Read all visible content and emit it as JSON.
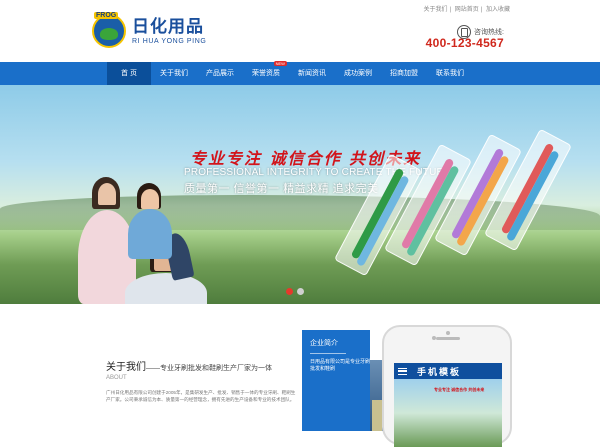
{
  "header": {
    "logo": {
      "badge": "FROG",
      "name": "日化用品",
      "pinyin": "RI HUA YONG PING"
    },
    "toplinks": [
      "关于我们",
      "网站首页",
      "加入收藏"
    ],
    "hotline_label": "咨询热线:",
    "hotline_number": "400-123-4567"
  },
  "nav": {
    "items": [
      {
        "label": "首 页",
        "active": true
      },
      {
        "label": "关于我们"
      },
      {
        "label": "产品展示"
      },
      {
        "label": "荣誉资质",
        "badge": "NEW"
      },
      {
        "label": "新闻资讯"
      },
      {
        "label": "成功案例"
      },
      {
        "label": "招商加盟"
      },
      {
        "label": "联系我们"
      }
    ]
  },
  "banner": {
    "slogan_cn": "专业专注 诚信合作 共创未来",
    "slogan_en": "PROFESSIONAL INTEGRITY TO CREATE THE FUTURE",
    "slogan_sub": "质量第一 信誉第一 精益求精 追求完美",
    "slides": 2,
    "active_slide": 1
  },
  "about": {
    "title": "关于我们",
    "subtitle": "——专业牙刷批发和鞋刷生产厂家为一体",
    "label": "ABOUT",
    "text": "广州日化用品有限公司创建于2005年，是集研发生产、批发、销售于一体的专业牙刷、鞋刷生产厂家。公司秉承诚信为本、质量第一的经营理念，拥有先进的生产设备和专业的技术团队。"
  },
  "sidepanel": {
    "title": "企业简介",
    "text": "日用品有限公司是专业牙刷批发和鞋刷"
  },
  "phone": {
    "screen_title": "手机模板",
    "mini_slogan": "专业专注 诚信合作 共创未来"
  },
  "colors": {
    "nav_blue": "#1a6fc9",
    "nav_active": "#0b4f9a",
    "hotline_red": "#d0281d",
    "slogan_red": "#d2141b"
  }
}
